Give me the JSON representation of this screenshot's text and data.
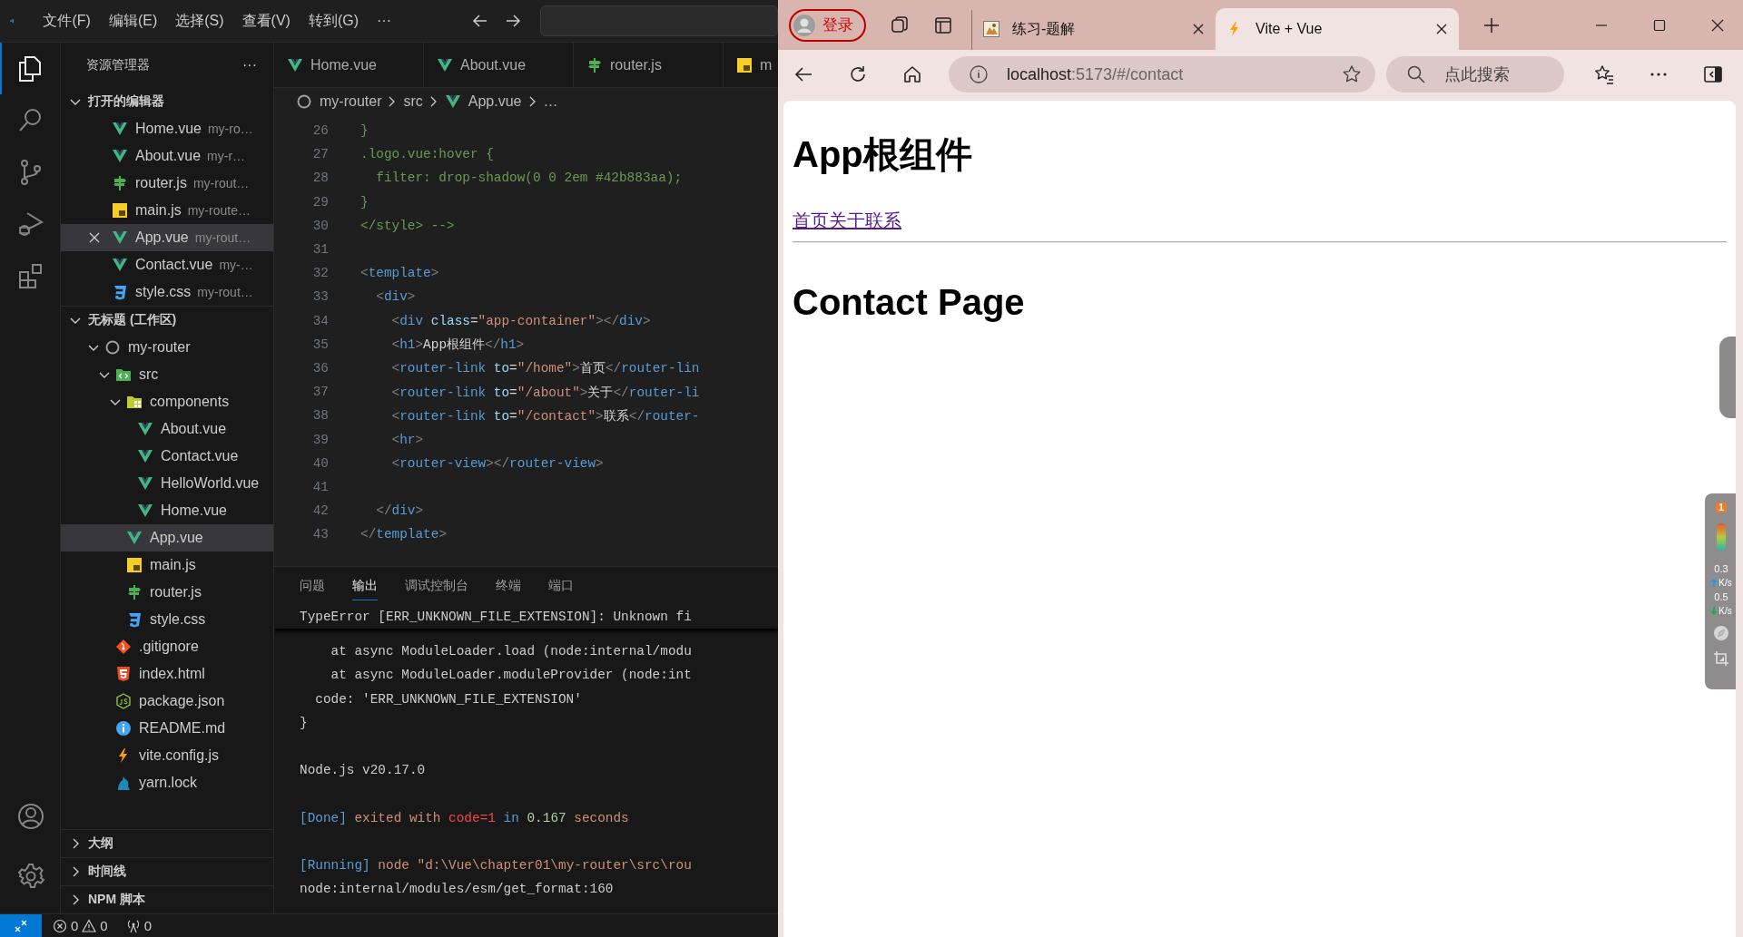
{
  "vscode": {
    "menu": [
      "文件(F)",
      "编辑(E)",
      "选择(S)",
      "查看(V)",
      "转到(G)"
    ],
    "menu_more": "···",
    "activity_bar": [
      {
        "kind": "files",
        "selected": true
      },
      {
        "kind": "search",
        "selected": false
      },
      {
        "kind": "source-control",
        "selected": false
      },
      {
        "kind": "run",
        "selected": false
      },
      {
        "kind": "extensions",
        "selected": false
      }
    ],
    "explorer": {
      "title": "资源管理器",
      "more": "···",
      "open_editors": {
        "title": "打开的编辑器",
        "expanded": true,
        "items": [
          {
            "name": "Home.vue",
            "path": "my-ro…",
            "kind": "vue",
            "selected": false
          },
          {
            "name": "About.vue",
            "path": "my-r…",
            "kind": "vue",
            "selected": false
          },
          {
            "name": "router.js",
            "path": "my-rout…",
            "kind": "router",
            "selected": false
          },
          {
            "name": "main.js",
            "path": "my-route…",
            "kind": "js",
            "selected": false
          },
          {
            "name": "App.vue",
            "path": "my-rout…",
            "kind": "vue",
            "selected": true
          },
          {
            "name": "Contact.vue",
            "path": "my-…",
            "kind": "vue",
            "selected": false
          },
          {
            "name": "style.css",
            "path": "my-rout…",
            "kind": "css",
            "selected": false
          }
        ]
      },
      "workspace": {
        "title": "无标题 (工作区)",
        "expanded": true,
        "tree": [
          {
            "name": "my-router",
            "kind": "repo",
            "expanded": true,
            "selected": false,
            "children": [
              {
                "name": "src",
                "kind": "folder-src",
                "expanded": true,
                "selected": false,
                "children": [
                  {
                    "name": "components",
                    "kind": "folder-components",
                    "expanded": true,
                    "selected": false,
                    "children": [
                      {
                        "name": "About.vue",
                        "kind": "vue",
                        "selected": false
                      },
                      {
                        "name": "Contact.vue",
                        "kind": "vue",
                        "selected": false
                      },
                      {
                        "name": "HelloWorld.vue",
                        "kind": "vue",
                        "selected": false
                      },
                      {
                        "name": "Home.vue",
                        "kind": "vue",
                        "selected": false
                      }
                    ]
                  },
                  {
                    "name": "App.vue",
                    "kind": "vue",
                    "selected": true
                  },
                  {
                    "name": "main.js",
                    "kind": "js",
                    "selected": false
                  },
                  {
                    "name": "router.js",
                    "kind": "router",
                    "selected": false
                  },
                  {
                    "name": "style.css",
                    "kind": "css",
                    "selected": false
                  }
                ]
              },
              {
                "name": ".gitignore",
                "kind": "git",
                "selected": false
              },
              {
                "name": "index.html",
                "kind": "html",
                "selected": false
              },
              {
                "name": "package.json",
                "kind": "node",
                "selected": false
              },
              {
                "name": "README.md",
                "kind": "info",
                "selected": false
              },
              {
                "name": "vite.config.js",
                "kind": "vite",
                "selected": false
              },
              {
                "name": "yarn.lock",
                "kind": "yarn",
                "selected": false
              }
            ]
          }
        ]
      },
      "sections": [
        {
          "title": "大纲",
          "expanded": false
        },
        {
          "title": "时间线",
          "expanded": false
        },
        {
          "title": "NPM 脚本",
          "expanded": false
        }
      ]
    },
    "editor": {
      "tabs": [
        {
          "name": "Home.vue",
          "kind": "vue"
        },
        {
          "name": "About.vue",
          "kind": "vue"
        },
        {
          "name": "router.js",
          "kind": "router"
        },
        {
          "name": "m",
          "kind": "js"
        }
      ],
      "breadcrumb": [
        {
          "text": "my-router",
          "kind": "repo"
        },
        {
          "text": "src"
        },
        {
          "text": "App.vue",
          "kind": "vue"
        },
        {
          "text": "…"
        }
      ],
      "lines": [
        {
          "number": "26",
          "tokens": [
            {
              "kind": "comment",
              "text": "}"
            }
          ]
        },
        {
          "number": "27",
          "tokens": [
            {
              "kind": "comment",
              "text": ".logo.vue:hover {"
            }
          ]
        },
        {
          "number": "28",
          "tokens": [
            {
              "kind": "comment",
              "text": "  filter: drop-shadow(0 0 2em #42b883aa);"
            }
          ]
        },
        {
          "number": "29",
          "tokens": [
            {
              "kind": "comment",
              "text": "}"
            }
          ]
        },
        {
          "number": "30",
          "tokens": [
            {
              "kind": "comment",
              "text": "</style> -->"
            }
          ]
        },
        {
          "number": "31"
        },
        {
          "number": "32",
          "tokens": [
            {
              "kind": "punct",
              "text": "<"
            },
            {
              "kind": "tag",
              "text": "template"
            },
            {
              "kind": "punct",
              "text": ">"
            }
          ]
        },
        {
          "number": "33",
          "tokens": [
            {
              "kind": "punct",
              "text": "  <"
            },
            {
              "kind": "tag",
              "text": "div"
            },
            {
              "kind": "punct",
              "text": ">"
            }
          ]
        },
        {
          "number": "34",
          "tokens": [
            {
              "kind": "punct",
              "text": "    <"
            },
            {
              "kind": "tag",
              "text": "div"
            },
            {
              "kind": "attr",
              "text": " class"
            },
            {
              "kind": "text",
              "text": "="
            },
            {
              "kind": "string",
              "text": "\"app-container\""
            },
            {
              "kind": "punct",
              "text": "></"
            },
            {
              "kind": "tag",
              "text": "div"
            },
            {
              "kind": "punct",
              "text": ">"
            }
          ]
        },
        {
          "number": "35",
          "tokens": [
            {
              "kind": "punct",
              "text": "    <"
            },
            {
              "kind": "tag",
              "text": "h1"
            },
            {
              "kind": "punct",
              "text": ">"
            },
            {
              "kind": "text",
              "text": "App根组件"
            },
            {
              "kind": "punct",
              "text": "</"
            },
            {
              "kind": "tag",
              "text": "h1"
            },
            {
              "kind": "punct",
              "text": ">"
            }
          ]
        },
        {
          "number": "36",
          "tokens": [
            {
              "kind": "punct",
              "text": "    <"
            },
            {
              "kind": "tag",
              "text": "router-link"
            },
            {
              "kind": "attr",
              "text": " to"
            },
            {
              "kind": "text",
              "text": "="
            },
            {
              "kind": "string",
              "text": "\"/home\""
            },
            {
              "kind": "punct",
              "text": ">"
            },
            {
              "kind": "text",
              "text": "首页"
            },
            {
              "kind": "punct",
              "text": "</"
            },
            {
              "kind": "tag",
              "text": "router-lin"
            }
          ]
        },
        {
          "number": "37",
          "tokens": [
            {
              "kind": "punct",
              "text": "    <"
            },
            {
              "kind": "tag",
              "text": "router-link"
            },
            {
              "kind": "attr",
              "text": " to"
            },
            {
              "kind": "text",
              "text": "="
            },
            {
              "kind": "string",
              "text": "\"/about\""
            },
            {
              "kind": "punct",
              "text": ">"
            },
            {
              "kind": "text",
              "text": "关于"
            },
            {
              "kind": "punct",
              "text": "</"
            },
            {
              "kind": "tag",
              "text": "router-li"
            }
          ]
        },
        {
          "number": "38",
          "tokens": [
            {
              "kind": "punct",
              "text": "    <"
            },
            {
              "kind": "tag",
              "text": "router-link"
            },
            {
              "kind": "attr",
              "text": " to"
            },
            {
              "kind": "text",
              "text": "="
            },
            {
              "kind": "string",
              "text": "\"/contact\""
            },
            {
              "kind": "punct",
              "text": ">"
            },
            {
              "kind": "text",
              "text": "联系"
            },
            {
              "kind": "punct",
              "text": "</"
            },
            {
              "kind": "tag",
              "text": "router-"
            }
          ]
        },
        {
          "number": "39",
          "tokens": [
            {
              "kind": "punct",
              "text": "    <"
            },
            {
              "kind": "tag",
              "text": "hr"
            },
            {
              "kind": "punct",
              "text": ">"
            }
          ]
        },
        {
          "number": "40",
          "tokens": [
            {
              "kind": "punct",
              "text": "    <"
            },
            {
              "kind": "tag",
              "text": "router-view"
            },
            {
              "kind": "punct",
              "text": "></"
            },
            {
              "kind": "tag",
              "text": "router-view"
            },
            {
              "kind": "punct",
              "text": ">"
            }
          ]
        },
        {
          "number": "41"
        },
        {
          "number": "42",
          "tokens": [
            {
              "kind": "punct",
              "text": "  </"
            },
            {
              "kind": "tag",
              "text": "div"
            },
            {
              "kind": "punct",
              "text": ">"
            }
          ]
        },
        {
          "number": "43",
          "tokens": [
            {
              "kind": "punct",
              "text": "</"
            },
            {
              "kind": "tag",
              "text": "template"
            },
            {
              "kind": "punct",
              "text": ">"
            }
          ]
        }
      ]
    },
    "panel": {
      "tabs": [
        {
          "label": "问题",
          "selected": false
        },
        {
          "label": "输出",
          "selected": true
        },
        {
          "label": "调试控制台",
          "selected": false
        },
        {
          "label": "终端",
          "selected": false
        },
        {
          "label": "端口",
          "selected": false
        }
      ],
      "sticky_line": "TypeError [ERR_UNKNOWN_FILE_EXTENSION]: Unknown fi",
      "blocks": [
        [
          {
            "tokens": [
              {
                "kind": "plain",
                "text": "    at async ModuleLoader.load (node:internal/modu"
              }
            ]
          },
          {
            "tokens": [
              {
                "kind": "plain",
                "text": "    at async ModuleLoader.moduleProvider (node:int"
              }
            ]
          },
          {
            "tokens": [
              {
                "kind": "plain",
                "text": "  code: 'ERR_UNKNOWN_FILE_EXTENSION'"
              }
            ]
          },
          {
            "tokens": [
              {
                "kind": "plain",
                "text": "}"
              }
            ]
          }
        ],
        [
          {
            "tokens": [
              {
                "kind": "plain",
                "text": "Node.js v20.17.0"
              }
            ]
          }
        ],
        [
          {
            "tokens": [
              {
                "kind": "info",
                "text": "[Done]"
              },
              {
                "kind": "warm",
                "text": " exited with "
              },
              {
                "kind": "error",
                "text": "code=1"
              },
              {
                "kind": "keyword",
                "text": " in "
              },
              {
                "kind": "number",
                "text": "0.167"
              },
              {
                "kind": "warm",
                "text": " seconds"
              }
            ]
          }
        ],
        [
          {
            "tokens": [
              {
                "kind": "info",
                "text": "[Running]"
              },
              {
                "kind": "warm",
                "text": " node \"d:\\Vue\\chapter01\\my-router\\src\\rou"
              }
            ]
          },
          {
            "tokens": [
              {
                "kind": "plain",
                "text": "node:internal/modules/esm/get_format:160"
              }
            ]
          }
        ]
      ]
    },
    "status_bar": {
      "errors": "0",
      "warnings": "0",
      "ports": "0"
    }
  },
  "browser": {
    "profile": "登录",
    "tabs": [
      {
        "title": "练习-题解",
        "kind": "picture",
        "selected": false
      },
      {
        "title": "Vite + Vue",
        "kind": "vite",
        "selected": true
      }
    ],
    "address": {
      "host": "localhost",
      "path": ":5173/#/contact"
    },
    "search": {
      "placeholder": "点此搜索"
    },
    "page": {
      "heading": "App根组件",
      "links": [
        "首页",
        "关于",
        "联系"
      ],
      "title": "Contact Page"
    },
    "widget": {
      "badge": "1",
      "upload": "0.3",
      "upload_unit": "K/s",
      "download": "0.5",
      "download_unit": "K/s"
    }
  }
}
